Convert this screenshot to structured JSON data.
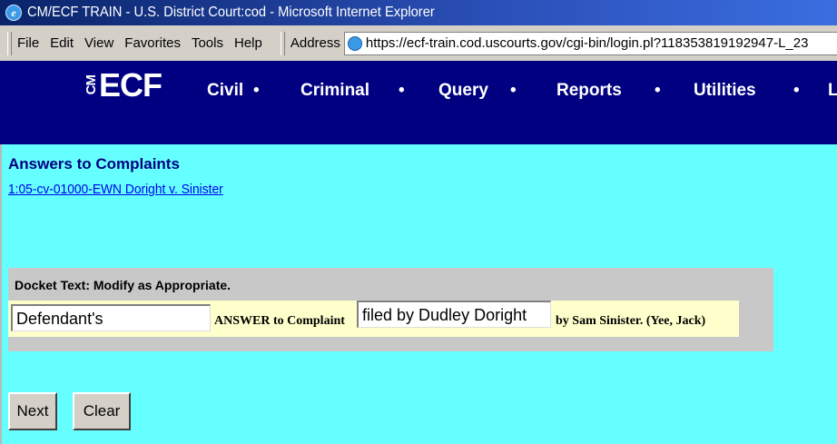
{
  "window": {
    "title": "CM/ECF TRAIN - U.S. District Court:cod - Microsoft Internet Explorer"
  },
  "menubar": {
    "items": [
      "File",
      "Edit",
      "View",
      "Favorites",
      "Tools",
      "Help"
    ],
    "address_label": "Address",
    "address_url": "https://ecf-train.cod.uscourts.gov/cgi-bin/login.pl?118353819192947-L_23"
  },
  "navbar": {
    "logo_cm": "CM",
    "logo_ecf": "ECF",
    "items": [
      "Civil",
      "Criminal",
      "Query",
      "Reports",
      "Utilities",
      "L"
    ],
    "separator": "•"
  },
  "page": {
    "title": "Answers to Complaints",
    "case_link": "1:05-cv-01000-EWN Doright v. Sinister"
  },
  "docket": {
    "label": "Docket Text: Modify as Appropriate.",
    "prefix_value": "Defendant's",
    "middle_text": "ANSWER to Complaint",
    "filed_by_value": "filed by Dudley Doright",
    "suffix_text": "by Sam Sinister. (Yee, Jack)"
  },
  "buttons": {
    "next": "Next",
    "clear": "Clear"
  }
}
